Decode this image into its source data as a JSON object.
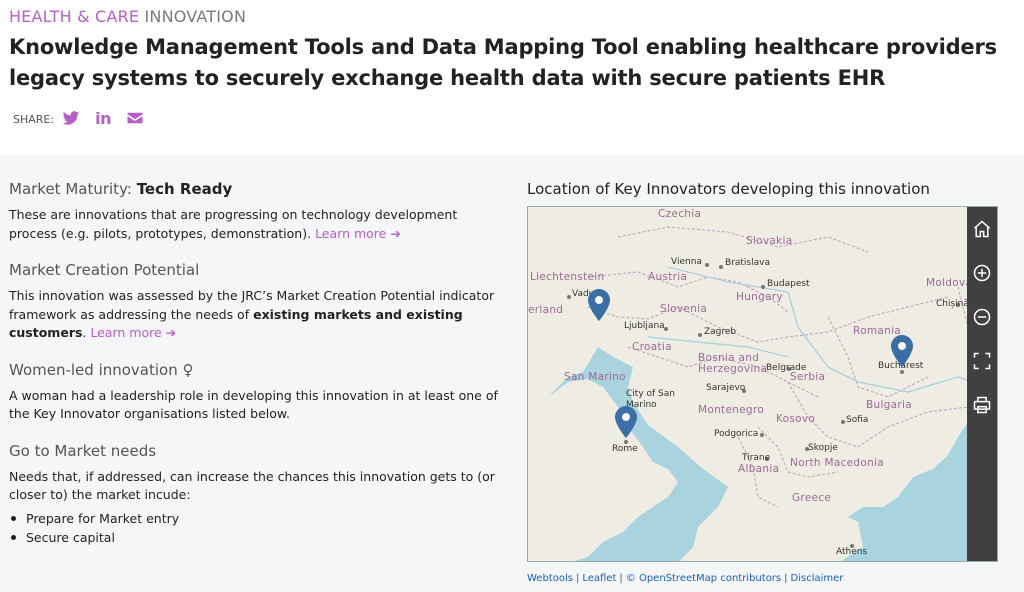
{
  "header": {
    "category_accent": "HEALTH & CARE",
    "category_rest": " INNOVATION",
    "title": "Knowledge Management Tools and Data Mapping Tool enabling healthcare providers legacy systems to securely exchange health data with secure patients EHR",
    "share_label": "SHARE:",
    "share_icons": [
      "twitter-icon",
      "linkedin-icon",
      "email-icon"
    ]
  },
  "market_maturity": {
    "label": "Market Maturity: ",
    "value": "Tech Ready",
    "description": "These are innovations that are progressing on technology development process (e.g. pilots, prototypes, demonstration). ",
    "learn_more": "Learn more ➔"
  },
  "market_creation": {
    "heading": "Market Creation Potential",
    "text_1": "This innovation was assessed by the JRC’s Market Creation Potential indicator framework as addressing the needs of ",
    "text_bold": "existing markets and existing customers",
    "text_2": ". ",
    "learn_more": "Learn more ➔"
  },
  "women_led": {
    "heading": "Women-led innovation",
    "icon": "♀",
    "description": "A woman had a leadership role in developing this innovation in at least one of the Key Innovator organisations listed below."
  },
  "go_to_market": {
    "heading": "Go to Market needs",
    "description": "Needs that, if addressed, can increase the chances this innovation gets to (or closer to) the market incude:",
    "items": [
      "Prepare for Market entry",
      "Secure capital"
    ]
  },
  "map": {
    "title": "Location of Key Innovators developing this innovation",
    "countries": [
      "Czechia",
      "Slovakia",
      "Austria",
      "Liechtenstein",
      "Hungary",
      "Slovenia",
      "Croatia",
      "Moldova",
      "Romania",
      "Bosnia and Herzegovina",
      "Serbia",
      "San Marino",
      "City of San Marino",
      "Montenegro",
      "Kosovo",
      "Bulgaria",
      "Albania",
      "North Macedonia",
      "Greece",
      "erland"
    ],
    "cities": [
      "Vienna",
      "Bratislava",
      "Budapest",
      "Vaduz",
      "Ljubljana",
      "Zagreb",
      "Belgrade",
      "Sarajevo",
      "Bucharest",
      "Chișinău",
      "Podgorica",
      "Sofia",
      "Skopje",
      "Tirane",
      "Rome",
      "Athens"
    ],
    "controls": [
      "home-icon",
      "zoom-in-icon",
      "zoom-out-icon",
      "fullscreen-icon",
      "print-icon"
    ],
    "marker_color": "#3a6ea5"
  },
  "attribution": {
    "webtools": "Webtools",
    "leaflet": "Leaflet",
    "osm": "© OpenStreetMap contributors",
    "disclaimer": "Disclaimer",
    "separator": "|"
  },
  "colors": {
    "accent": "#b65fc6",
    "panel_bg": "#f5f6f8",
    "link": "#1a5fb4"
  }
}
